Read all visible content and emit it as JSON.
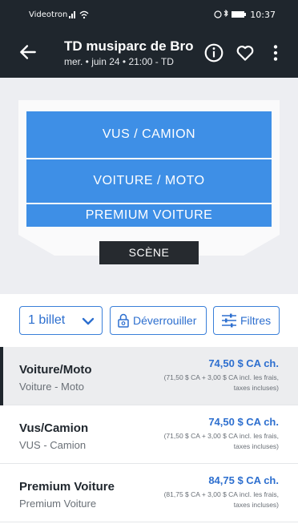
{
  "status_bar": {
    "carrier": "Videotron",
    "time": "10:37"
  },
  "header": {
    "title": "TD musiparc de Brom",
    "subtitle": "mer. • juin 24 • 21:00 - TD"
  },
  "venue_map": {
    "sections": [
      "VUS / CAMION",
      "VOITURE / MOTO",
      "PREMIUM VOITURE"
    ],
    "stage": "SCÈNE",
    "section_color": "#3e8fe6"
  },
  "filters": {
    "quantity": "1 billet",
    "unlock": "Déverrouiller",
    "filters": "Filtres"
  },
  "listings": [
    {
      "name": "Voiture/Moto",
      "sub": "Voiture - Moto",
      "price": "74,50 $ CA ch.",
      "fees_line1": "(71,50 $ CA + 3,00 $ CA incl. les frais,",
      "fees_line2": "taxes incluses)",
      "selected": true
    },
    {
      "name": "Vus/Camion",
      "sub": "VUS - Camion",
      "price": "74,50 $ CA ch.",
      "fees_line1": "(71,50 $ CA + 3,00 $ CA incl. les frais,",
      "fees_line2": "taxes incluses)",
      "selected": false
    },
    {
      "name": "Premium Voiture",
      "sub": "Premium Voiture",
      "price": "84,75 $ CA ch.",
      "fees_line1": "(81,75 $ CA + 3,00 $ CA incl. les frais,",
      "fees_line2": "taxes incluses)",
      "selected": false
    }
  ],
  "colors": {
    "header_bg": "#1f262d",
    "accent": "#2d6fcf"
  }
}
